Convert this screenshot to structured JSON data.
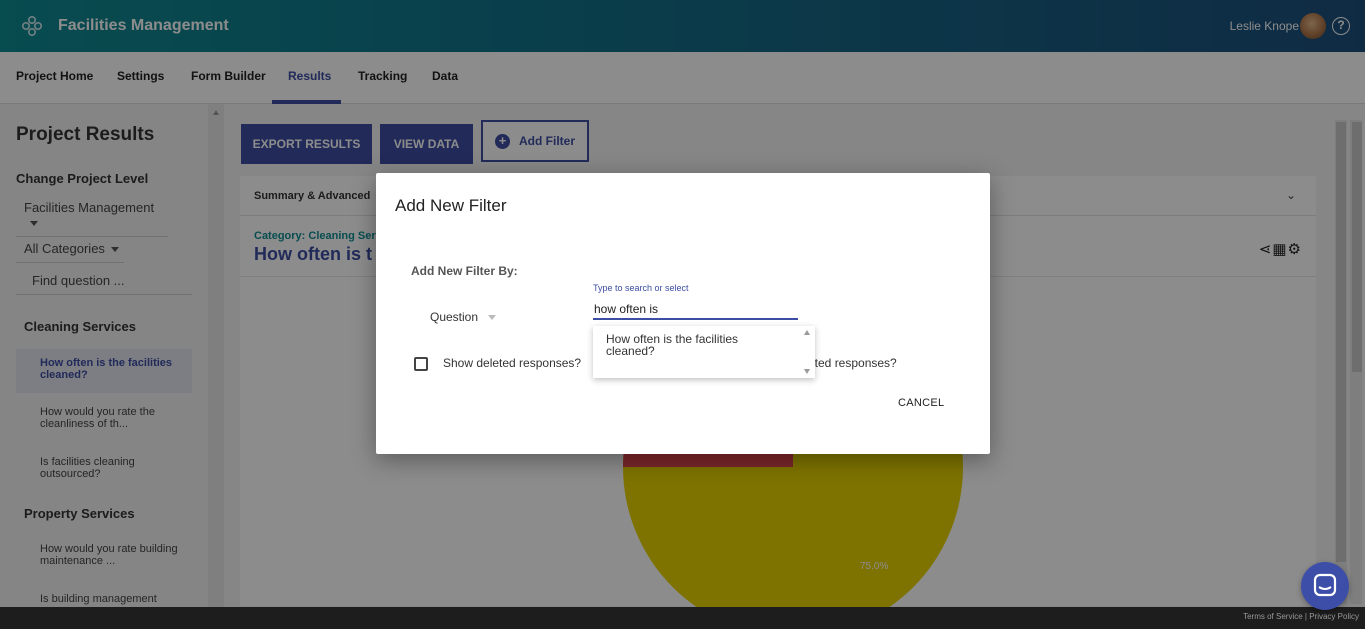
{
  "header": {
    "app_title": "Facilities Management",
    "user_name": "Leslie Knope",
    "help_symbol": "?"
  },
  "tabs": [
    {
      "label": "Project Home"
    },
    {
      "label": "Settings"
    },
    {
      "label": "Form Builder"
    },
    {
      "label": "Results",
      "active": true
    },
    {
      "label": "Tracking"
    },
    {
      "label": "Data"
    }
  ],
  "sidebar": {
    "title": "Project Results",
    "change_level_label": "Change Project Level",
    "level_value": "Facilities Management",
    "categories_value": "All Categories",
    "find_question_placeholder": "Find question ...",
    "sections": [
      {
        "title": "Cleaning Services",
        "items": [
          {
            "label": "How often is the facilities cleaned?",
            "selected": true
          },
          {
            "label": "How would you rate the cleanliness of th..."
          },
          {
            "label": "Is facilities cleaning outsourced?"
          }
        ]
      },
      {
        "title": "Property Services",
        "items": [
          {
            "label": "How would you rate building maintenance ..."
          },
          {
            "label": "Is building management"
          }
        ]
      }
    ]
  },
  "toolbar": {
    "export_label": "EXPORT RESULTS",
    "view_data_label": "VIEW DATA",
    "add_filter_label": "Add Filter",
    "add_filter_icon": "+"
  },
  "results_card": {
    "summary_label": "Summary & Advanced",
    "category_label": "Category: Cleaning Serv",
    "question_title": "How often is t",
    "tools_icons": "⋖▦⚙",
    "collapse_icon": "⌄",
    "pie_label": "75.0%"
  },
  "modal": {
    "title": "Add New Filter",
    "filter_by_label": "Add New Filter By:",
    "filter_type_value": "Question",
    "search_hint": "Type to search or select",
    "search_value": "how often is",
    "dropdown_option": "How often is the facilities cleaned?",
    "show_deleted_label": "Show deleted responses?",
    "show_deleted_label_tail": "eted responses?",
    "cancel_label": "CANCEL"
  },
  "footer": {
    "terms": "Terms of Service",
    "privacy": "Privacy Policy"
  },
  "colors": {
    "brand": "#3c4ea3",
    "teal": "#0f8c92",
    "pie_yellow": "#e5d200",
    "pie_red": "#e0464f"
  }
}
